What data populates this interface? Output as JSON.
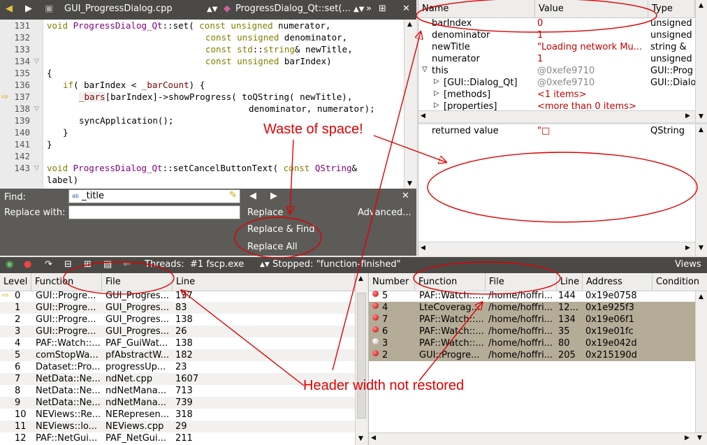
{
  "editor": {
    "file_name": "GUI_ProgressDialog.cpp",
    "symbol": "ProgressDialog_Qt::set(...",
    "lines": [
      {
        "n": "131"
      },
      {
        "n": "132"
      },
      {
        "n": "133"
      },
      {
        "n": "134"
      },
      {
        "n": "135"
      },
      {
        "n": "136"
      },
      {
        "n": "137"
      },
      {
        "n": "138"
      },
      {
        "n": "139"
      },
      {
        "n": "140"
      },
      {
        "n": "141"
      },
      {
        "n": "142"
      },
      {
        "n": "143"
      }
    ],
    "code": {
      "l131_kw": "void ",
      "l131_fn": "ProgressDialog_Qt",
      "l131_rest": "::set( ",
      "l131_kw2": "const unsigned ",
      "l131_tail": "numerator,",
      "l132_kw": "const unsigned ",
      "l132_tail": "denominator,",
      "l133_kw": "const std",
      "l133_mid": "::",
      "l133_kw2": "string",
      "l133_tail": "& newTitle,",
      "l134_kw": "const unsigned ",
      "l134_tail": "barIndex)",
      "l135": "{",
      "l136_kw": "if",
      "l136_rest": "( barIndex < ",
      "l136_mb": "_barCount",
      "l136_tail": ") {",
      "l137_mb": "_bars",
      "l137_rest": "[barIndex]->showProgress( toQString( newTitle),",
      "l138": "denominator, numerator);",
      "l139": "syncApplication();",
      "l140": "}",
      "l141": "}",
      "l142": "",
      "l143_kw": "void ",
      "l143_fn": "ProgressDialog_Qt",
      "l143_rest": "::setCancelButtonText( ",
      "l143_kw2": "const ",
      "l143_ty": "QString",
      "l143_tail": "&",
      "l143b": "label)"
    }
  },
  "find": {
    "find_label": "Find:",
    "find_value": "_title",
    "replace_label": "Replace with:",
    "replace_value": "",
    "replace_btn": "Replace",
    "replace_find_btn": "Replace & Find",
    "replace_all_btn": "Replace All",
    "advanced_btn": "Advanced..."
  },
  "locals": {
    "headers": {
      "name": "Name",
      "value": "Value",
      "type": "Type"
    },
    "rows": [
      {
        "name": "barIndex",
        "value": "0",
        "type": "unsigned",
        "vclass": "red"
      },
      {
        "name": "denominator",
        "value": "1",
        "type": "unsigned",
        "vclass": "red"
      },
      {
        "name": "newTitle",
        "value": "\"Loading network Mu...",
        "type": "string &",
        "vclass": "red"
      },
      {
        "name": "numerator",
        "value": "1",
        "type": "unsigned",
        "vclass": "red"
      },
      {
        "name": "this",
        "value": "@0xefe9710",
        "type": "GUI::Prog",
        "vclass": "gray"
      },
      {
        "name": "[GUI::Dialog_Qt]",
        "value": "@0xefe9710",
        "type": "GUI::Dialo",
        "vclass": "gray"
      },
      {
        "name": "[methods]",
        "value": "<1 items>",
        "type": "",
        "vclass": "red"
      },
      {
        "name": "[properties]",
        "value": "<more than 0 items>",
        "type": "",
        "vclass": "red"
      }
    ],
    "returned": {
      "name": "returned value",
      "value": "\"□",
      "type": "QString"
    }
  },
  "debug_toolbar": {
    "threads_label": "Threads:",
    "thread_value": "#1 fscp.exe",
    "status": "Stopped: \"function-finished\"",
    "views": "Views"
  },
  "stack": {
    "headers": {
      "level": "Level",
      "function": "Function",
      "file": "File",
      "line": "Line"
    },
    "rows": [
      {
        "level": "0",
        "function": "GUI::Progre...",
        "file": "GUI_Progres...",
        "line": "137"
      },
      {
        "level": "1",
        "function": "GUI::Progre...",
        "file": "GUI_Progres...",
        "line": "83"
      },
      {
        "level": "2",
        "function": "GUI::Progre...",
        "file": "GUI_Progres...",
        "line": "138"
      },
      {
        "level": "3",
        "function": "GUI::Progre...",
        "file": "GUI_Progres...",
        "line": "26"
      },
      {
        "level": "4",
        "function": "PAF::Watch::...",
        "file": "PAF_GuiWat...",
        "line": "138"
      },
      {
        "level": "5",
        "function": "comStopWa...",
        "file": "pfAbstractW...",
        "line": "182"
      },
      {
        "level": "6",
        "function": "Dataset::Pro...",
        "file": "progressUp...",
        "line": "23"
      },
      {
        "level": "7",
        "function": "NetData::Ne...",
        "file": "ndNet.cpp",
        "line": "1607"
      },
      {
        "level": "8",
        "function": "NetData::Ne...",
        "file": "ndNetMana...",
        "line": "713"
      },
      {
        "level": "9",
        "function": "NetData::Ne...",
        "file": "ndNetMana...",
        "line": "739"
      },
      {
        "level": "10",
        "function": "NEViews::Re...",
        "file": "NERepresen...",
        "line": "318"
      },
      {
        "level": "11",
        "function": "NEViews::lo...",
        "file": "NEViews.cpp",
        "line": "29"
      },
      {
        "level": "12",
        "function": "PAF::NetGui...",
        "file": "PAF_NetGui...",
        "line": "211"
      }
    ]
  },
  "breakpoints": {
    "headers": {
      "number": "Number",
      "function": "Function",
      "file": "File",
      "line": "Line",
      "address": "Address",
      "condition": "Condition"
    },
    "rows": [
      {
        "number": "5",
        "function": "PAF::Watch::...",
        "file": "/home/hoffri...",
        "line": "144",
        "address": "0x19e0758",
        "enabled": true,
        "sel": false
      },
      {
        "number": "4",
        "function": "LteCoverag...",
        "file": "/home/hoffri...",
        "line": "12...",
        "address": "0x1e925f3",
        "enabled": true,
        "sel": true
      },
      {
        "number": "7",
        "function": "PAF::Watch::...",
        "file": "/home/hoffri...",
        "line": "134",
        "address": "0x19e06f1",
        "enabled": true,
        "sel": true
      },
      {
        "number": "6",
        "function": "PAF::Watch::...",
        "file": "/home/hoffri...",
        "line": "35",
        "address": "0x19e01fc",
        "enabled": true,
        "sel": true
      },
      {
        "number": "3",
        "function": "PAF::Watch::...",
        "file": "/home/hoffri...",
        "line": "80",
        "address": "0x19e042d",
        "enabled": false,
        "sel": true
      },
      {
        "number": "2",
        "function": "GUI::Progre...",
        "file": "/home/hoffri...",
        "line": "205",
        "address": "0x215190d",
        "enabled": true,
        "sel": true
      }
    ]
  },
  "annotations": {
    "waste": "Waste of space!",
    "header": "Header width not restored"
  },
  "colors": {
    "annotation": "#e00000",
    "toolbar": "#4a4946",
    "find_panel": "#5c5b58",
    "selection": "#b5ac98"
  }
}
